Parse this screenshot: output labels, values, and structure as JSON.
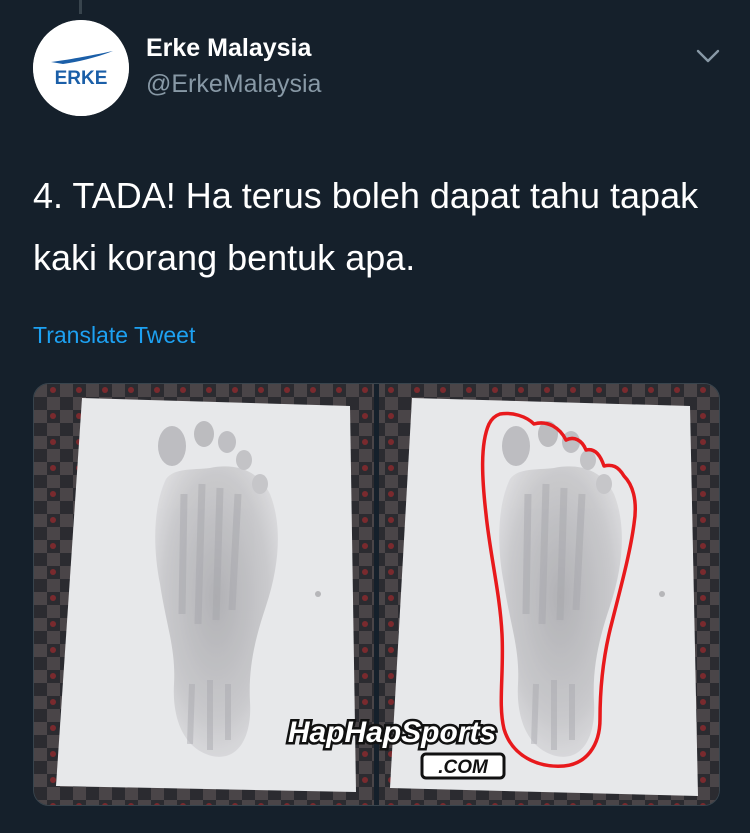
{
  "tweet": {
    "author_name": "Erke Malaysia",
    "author_handle": "@ErkeMalaysia",
    "text": "4. TADA! Ha terus boleh dapat tahu tapak kaki korang bentuk apa.",
    "translate_label": "Translate Tweet"
  },
  "avatar": {
    "logo_text": "ERKE",
    "brand_color": "#1b5fa8"
  },
  "media": {
    "watermark_main": "HapHapSports",
    "watermark_sub": ".COM",
    "outline_color": "#e8191c"
  },
  "icons": {
    "menu": "chevron-down-icon"
  },
  "colors": {
    "background": "#15202b",
    "text_primary": "#ffffff",
    "text_secondary": "#8899a6",
    "link": "#1da1f2"
  }
}
